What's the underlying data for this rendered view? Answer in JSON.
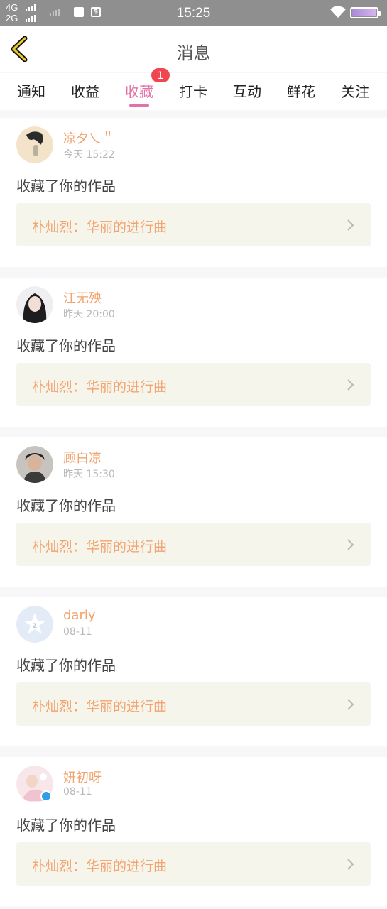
{
  "status_bar": {
    "net_top": "4G",
    "net_bottom": "2G",
    "time": "15:25"
  },
  "nav": {
    "title": "消息"
  },
  "tabs": [
    {
      "label": "通知"
    },
    {
      "label": "收益"
    },
    {
      "label": "收藏",
      "active": true,
      "badge": "1"
    },
    {
      "label": "打卡"
    },
    {
      "label": "互动"
    },
    {
      "label": "鲜花"
    },
    {
      "label": "关注"
    }
  ],
  "notifications": [
    {
      "user": "凉夕乀＂",
      "time": "今天 15:22",
      "action": "收藏了你的作品",
      "work": "朴灿烈：华丽的进行曲"
    },
    {
      "user": "江无殃",
      "time": "昨天 20:00",
      "action": "收藏了你的作品",
      "work": "朴灿烈：华丽的进行曲"
    },
    {
      "user": "顾白凉",
      "time": "昨天 15:30",
      "action": "收藏了你的作品",
      "work": "朴灿烈：华丽的进行曲"
    },
    {
      "user": "darly",
      "time": "08-11",
      "action": "收藏了你的作品",
      "work": "朴灿烈：华丽的进行曲"
    },
    {
      "user": "妍初呀",
      "time": "08-11",
      "action": "收藏了你的作品",
      "work": "朴灿烈：华丽的进行曲"
    }
  ],
  "colors": {
    "accent": "#e472a6",
    "username": "#f0a36c",
    "badge": "#f0464f"
  }
}
